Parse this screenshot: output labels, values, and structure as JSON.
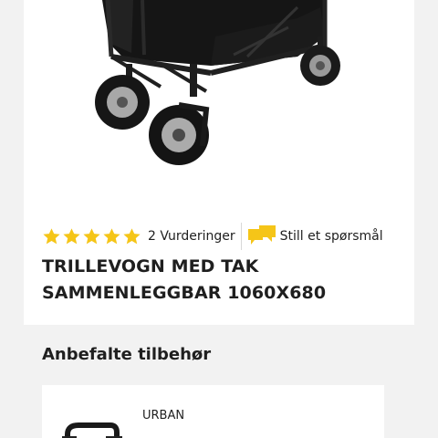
{
  "product": {
    "rating": {
      "stars_filled": 5,
      "stars_total": 5,
      "star_color": "#f5c518",
      "reviews_label": "2 Vurderinger"
    },
    "ask_question_label": "Still et spørsmål",
    "ask_icon": "chat-bubbles-icon",
    "ask_icon_color": "#f5c518",
    "title": "TRILLEVOGN MED TAK\nSAMMENLEGGBAR 1060X680"
  },
  "accessories": {
    "heading": "Anbefalte tilbehør",
    "items": [
      {
        "brand": "URBAN"
      }
    ]
  }
}
